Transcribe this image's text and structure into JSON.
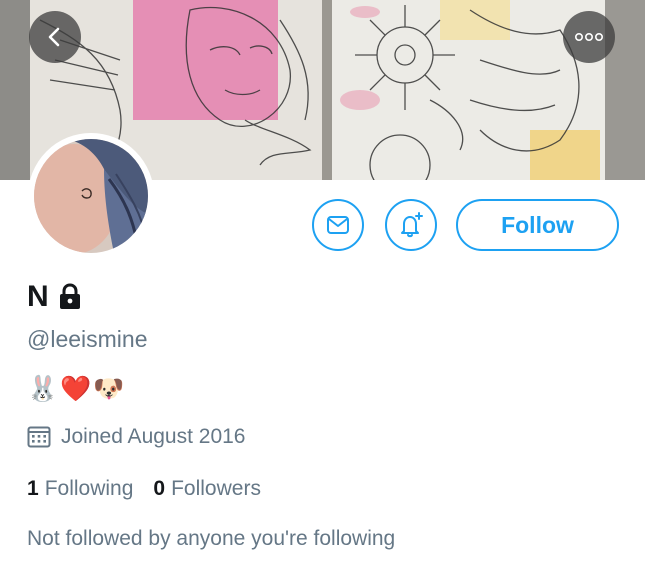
{
  "header": {
    "back_icon": "chevron-left-icon",
    "more_icon": "ellipsis-icon"
  },
  "profile": {
    "name": "N",
    "handle": "@leeismine",
    "bio": "🐰❤️🐶",
    "joined": "Joined August 2016",
    "following_count": "1",
    "following_label": "Following",
    "followers_count": "0",
    "followers_label": "Followers",
    "mutual_text": "Not followed by anyone you're following"
  },
  "actions": {
    "message_icon": "envelope-icon",
    "notify_icon": "bell-plus-icon",
    "follow_label": "Follow"
  },
  "colors": {
    "accent": "#1da1f2",
    "secondary_text": "#657786",
    "primary_text": "#14171a"
  }
}
